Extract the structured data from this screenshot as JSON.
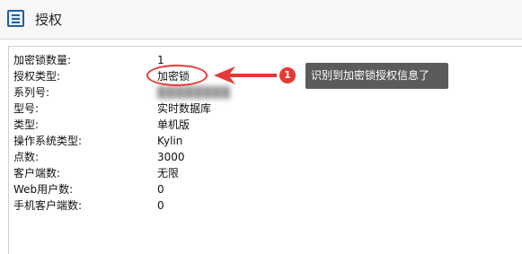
{
  "window": {
    "title": "授权",
    "icon": "license-list-icon"
  },
  "license": {
    "rows": [
      {
        "label": "加密锁数量:",
        "value": "1"
      },
      {
        "label": "授权类型:",
        "value": "加密锁"
      },
      {
        "label": "系列号:",
        "value": "████████"
      },
      {
        "label": "型号:",
        "value": "实时数据库"
      },
      {
        "label": "类型:",
        "value": "单机版"
      },
      {
        "label": "操作系统类型:",
        "value": "Kylin"
      },
      {
        "label": "点数:",
        "value": "3000"
      },
      {
        "label": "客户端数:",
        "value": "无限"
      },
      {
        "label": "Web用户数:",
        "value": "0"
      },
      {
        "label": "手机客户端数:",
        "value": "0"
      }
    ]
  },
  "annotation": {
    "step": "1",
    "text": "识别到加密锁授权信息了",
    "color": "#e53935",
    "callout_bg": "#5b5b5b"
  }
}
